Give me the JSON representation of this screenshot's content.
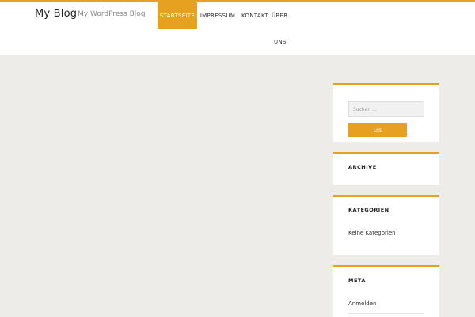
{
  "site": {
    "title": "My Blog",
    "tagline": "My WordPress Blog"
  },
  "nav": {
    "startseite": "STARTSEITE",
    "impressum": "IMPRESSUM",
    "kontakt": "KONTAKT",
    "ueber": "ÜBER",
    "uns": "UNS"
  },
  "sidebar": {
    "search": {
      "placeholder": "Suchen …",
      "button_label": "Los"
    },
    "archive": {
      "title": "ARCHIVE"
    },
    "kategorien": {
      "title": "KATEGORIEN",
      "empty_text": "Keine Kategorien"
    },
    "meta": {
      "title": "META",
      "items": [
        "Anmelden"
      ]
    }
  },
  "colors": {
    "accent": "#e6a120",
    "page_bg": "#eeece8",
    "header_bg": "#ffffff"
  }
}
